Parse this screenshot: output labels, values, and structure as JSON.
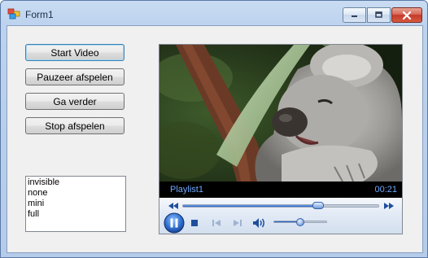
{
  "window": {
    "title": "Form1",
    "controls": {
      "minimize": "minimize",
      "maximize": "maximize",
      "close": "close"
    }
  },
  "buttons": {
    "start": "Start Video",
    "pause": "Pauzeer afspelen",
    "continue": "Ga verder",
    "stop": "Stop afspelen"
  },
  "listbox": {
    "items": [
      "invisible",
      "none",
      "mini",
      "full"
    ]
  },
  "player": {
    "playlist_name": "Playlist1",
    "elapsed_time": "00:21",
    "seek_progress": 0.69,
    "volume_level": 0.5,
    "state": "playing",
    "icons": {
      "rewind": "rewind-icon",
      "fast_forward": "fast-forward-icon",
      "pause": "pause-icon",
      "stop": "stop-icon",
      "previous": "previous-icon",
      "next": "next-icon",
      "volume": "volume-icon"
    },
    "accent_color": "#2a62c8"
  }
}
